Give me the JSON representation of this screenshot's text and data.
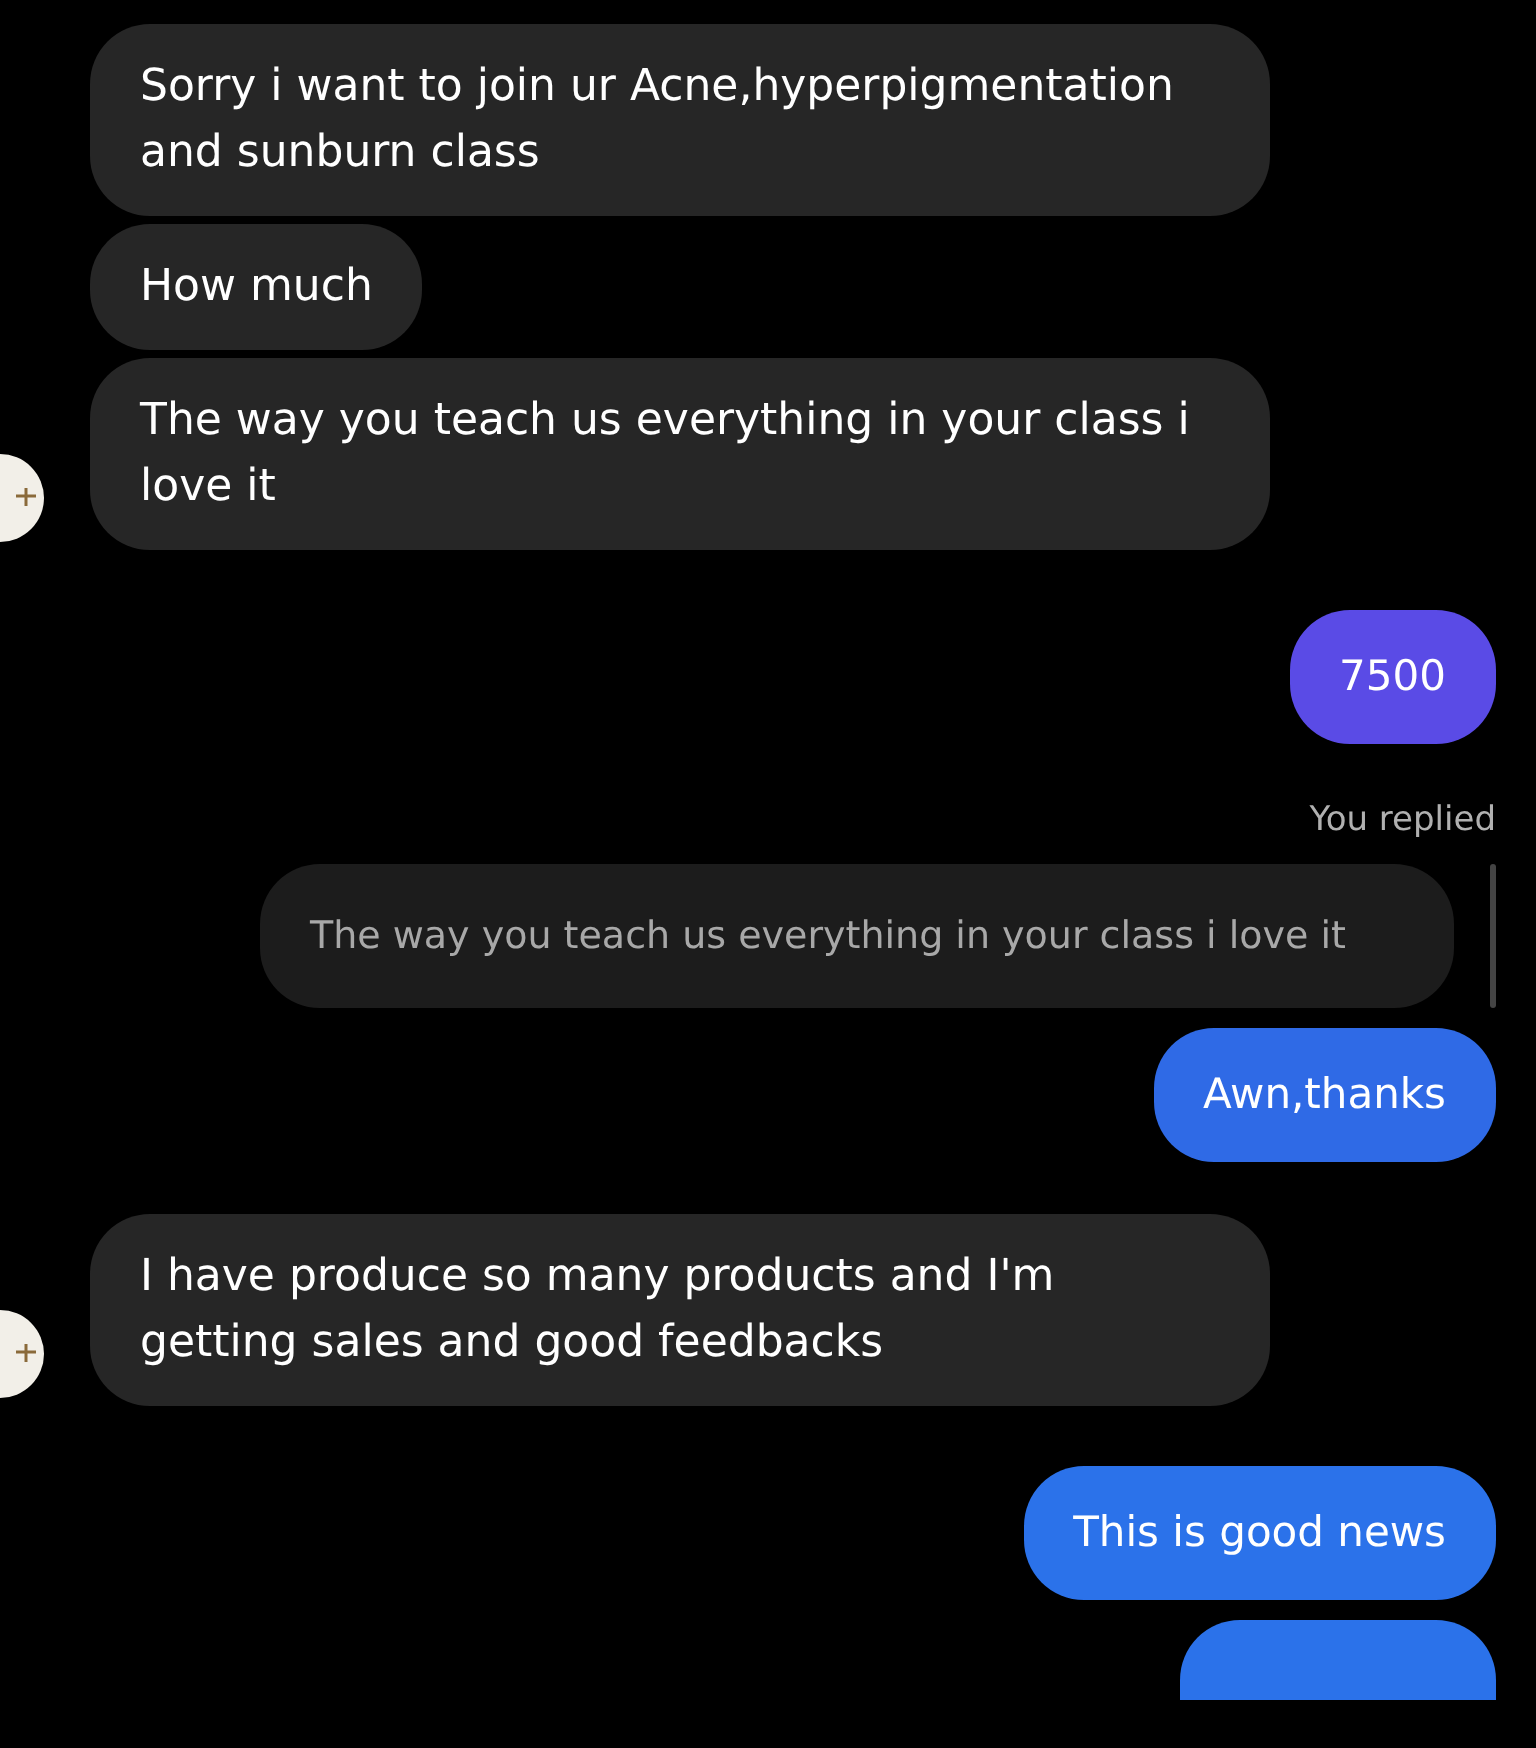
{
  "messages": [
    {
      "kind": "incoming",
      "text": "Sorry i want to join ur Acne,hyperpigmentation and sunburn class",
      "avatar": false
    },
    {
      "kind": "incoming",
      "text": "How much",
      "avatar": false
    },
    {
      "kind": "incoming",
      "text": "The way you teach us everything in your class i love it",
      "avatar": true
    },
    {
      "kind": "outgoing",
      "text": "7500",
      "color": "#5a4be6"
    },
    {
      "kind": "reply_label",
      "text": "You replied"
    },
    {
      "kind": "reply_quote",
      "text": "The way you teach us everything in your class i love it"
    },
    {
      "kind": "outgoing",
      "text": "Awn,thanks",
      "color": "#2f6ae6"
    },
    {
      "kind": "incoming",
      "text": "I have produce so many products and I'm getting sales and good feedbacks",
      "avatar": true
    },
    {
      "kind": "outgoing",
      "text": "This is good news",
      "color": "#2b72ea"
    },
    {
      "kind": "outgoing_cut",
      "color": "#2b72ea"
    }
  ]
}
